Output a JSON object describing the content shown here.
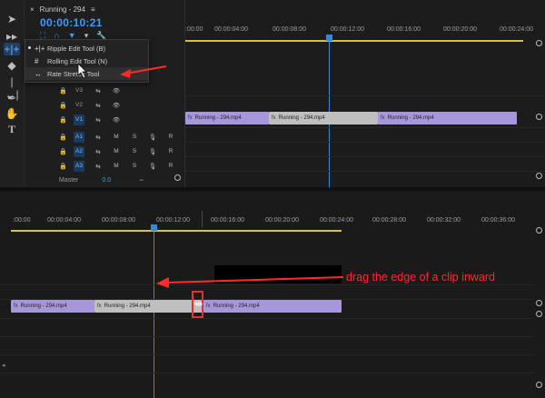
{
  "sequence": {
    "close_glyph": "×",
    "title": "Running - 294",
    "menu_glyph": "≡",
    "timecode": "00:00:10:21"
  },
  "tool_menu": {
    "items": [
      {
        "label": "Ripple Edit Tool (B)",
        "glyph": "+|+"
      },
      {
        "label": "Rolling Edit Tool (N)",
        "glyph": "#"
      },
      {
        "label": "Rate Stretch Tool",
        "glyph": "↔"
      }
    ]
  },
  "tracks": [
    {
      "name": "V3",
      "lock": "🔒",
      "eye": "👁"
    },
    {
      "name": "V2",
      "lock": "🔒",
      "eye": "👁"
    },
    {
      "name": "V1",
      "lock": "🔒",
      "eye": "👁"
    },
    {
      "name": "A1",
      "lock": "🔒",
      "m": "M",
      "s": "S",
      "mic": "🎙",
      "r": "R"
    },
    {
      "name": "A2",
      "lock": "🔒",
      "m": "M",
      "s": "S",
      "mic": "🎙",
      "r": "R"
    },
    {
      "name": "A3",
      "lock": "🔒",
      "m": "M",
      "s": "S",
      "mic": "🎙",
      "r": "R"
    }
  ],
  "master": {
    "label": "Master",
    "value": "0.0"
  },
  "ruler_top": [
    ":00:00",
    "00:00:04:00",
    "00:00:08:00",
    "00:00:12:00",
    "00:00:16:00",
    "00:00:20:00",
    "00:00:24:00"
  ],
  "ruler_bottom": [
    ":00:00",
    "00:00:04:00",
    "00:00:08:00",
    "00:00:12:00",
    "00:00:16:00",
    "00:00:20:00",
    "00:00:24:00",
    "00:00:28:00",
    "00:00:32:00",
    "00:00:36:00"
  ],
  "clips_top": [
    {
      "label": "Running - 294.mp4",
      "fx": "fx",
      "color": "purple"
    },
    {
      "label": "Running - 294.mp4",
      "fx": "fx",
      "color": "gray"
    },
    {
      "label": "Running - 294.mp4",
      "fx": "fx",
      "color": "purple"
    }
  ],
  "clips_bottom": [
    {
      "label": "Running - 294.mp4",
      "fx": "fx",
      "color": "purple"
    },
    {
      "label": "Running - 294.mp4",
      "fx": "fx",
      "color": "gray"
    },
    {
      "label": "Running - 294.mp4",
      "fx": "fx",
      "color": "purple"
    }
  ],
  "annotation": {
    "text": "drag the edge of a clip inward"
  },
  "colors": {
    "accent": "#2d88e6",
    "work_area": "#d8c23a",
    "annotation": "#ff2a2a"
  }
}
